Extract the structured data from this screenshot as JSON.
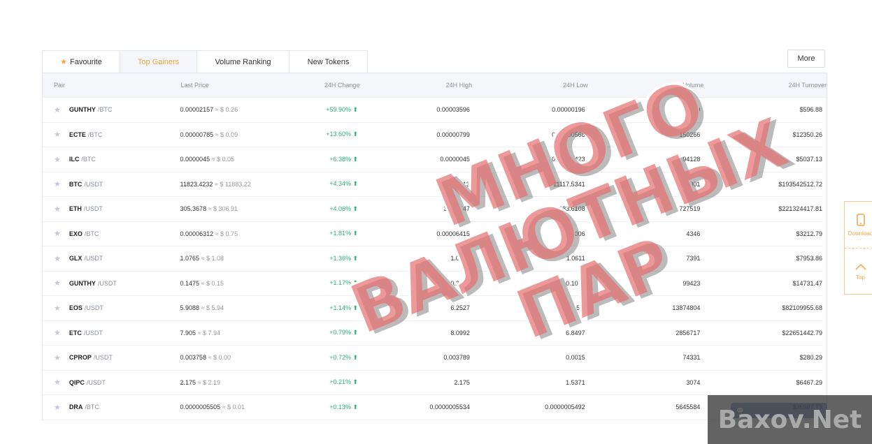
{
  "tabs": [
    {
      "label": "Favourite",
      "icon": "star-icon"
    },
    {
      "label": "Top Gainers",
      "active": true
    },
    {
      "label": "Volume Ranking"
    },
    {
      "label": "New Tokens"
    }
  ],
  "more_label": "More",
  "columns": [
    "Pair",
    "Last Price",
    "24H Change",
    "24H High",
    "24H Low",
    "24H Volume",
    "24H Turnover"
  ],
  "rows": [
    {
      "base": "GUNTHY",
      "quote": "/BTC",
      "price": "0.00002157",
      "usd": "≈ $ 0.26",
      "change": "+59.90%",
      "high": "0.00003596",
      "low": "0.00000196",
      "volume": "2889",
      "turnover": "$596.88"
    },
    {
      "base": "ECTE",
      "quote": "/BTC",
      "price": "0.00000785",
      "usd": "≈ $ 0.09",
      "change": "+13.60%",
      "high": "0.00000799",
      "low": "0.00000568",
      "volume": "150266",
      "turnover": "$12350.26"
    },
    {
      "base": "ILC",
      "quote": "/BTC",
      "price": "0.0000045",
      "usd": "≈ $ 0.05",
      "change": "+6.38%",
      "high": "0.0000045",
      "low": "0.00000423",
      "volume": "94128",
      "turnover": "$5037.13"
    },
    {
      "base": "BTC",
      "quote": "/USDT",
      "price": "11823.4232",
      "usd": "≈ $ 11883.22",
      "change": "+4.34%",
      "high": "11930.1813",
      "low": "11117.5341",
      "volume": "16801",
      "turnover": "$193542512.72"
    },
    {
      "base": "ETH",
      "quote": "/USDT",
      "price": "305.3678",
      "usd": "≈ $ 306.91",
      "change": "+4.06%",
      "high": "310.1747",
      "low": "283.6108",
      "volume": "727519",
      "turnover": "$221324417.81"
    },
    {
      "base": "EXO",
      "quote": "/BTC",
      "price": "0.00006312",
      "usd": "≈ $ 0.75",
      "change": "+1.81%",
      "high": "0.00006415",
      "low": "0.00006",
      "volume": "4346",
      "turnover": "$3212.79"
    },
    {
      "base": "GLX",
      "quote": "/USDT",
      "price": "1.0765",
      "usd": "≈ $ 1.08",
      "change": "+1.36%",
      "high": "1.0787",
      "low": "1.0611",
      "volume": "7391",
      "turnover": "$7953.86"
    },
    {
      "base": "GUNTHY",
      "quote": "/USDT",
      "price": "0.1475",
      "usd": "≈ $ 0.15",
      "change": "+1.17%",
      "high": "0.2208",
      "low": "0.1075",
      "volume": "99423",
      "turnover": "$14731.47"
    },
    {
      "base": "EOS",
      "quote": "/USDT",
      "price": "5.9088",
      "usd": "≈ $ 5.94",
      "change": "+1.14%",
      "high": "6.2527",
      "low": "5.5",
      "volume": "13874804",
      "turnover": "$82109955.68"
    },
    {
      "base": "ETC",
      "quote": "/USDT",
      "price": "7.905",
      "usd": "≈ $ 7.94",
      "change": "+0.79%",
      "high": "8.0992",
      "low": "6.8497",
      "volume": "2856717",
      "turnover": "$22651442.79"
    },
    {
      "base": "CPROP",
      "quote": "/USDT",
      "price": "0.003758",
      "usd": "≈ $ 0.00",
      "change": "+0.72%",
      "high": "0.003789",
      "low": "0.0015",
      "volume": "74331",
      "turnover": "$280.29"
    },
    {
      "base": "QIPC",
      "quote": "/USDT",
      "price": "2.175",
      "usd": "≈ $ 2.19",
      "change": "+0.21%",
      "high": "2.175",
      "low": "1.5371",
      "volume": "3074",
      "turnover": "$6467.29"
    },
    {
      "base": "DRA",
      "quote": "/BTC",
      "price": "0.0000005505",
      "usd": "≈ $ 0.01",
      "change": "+0.13%",
      "high": "0.0000005534",
      "low": "0.0000005492",
      "volume": "5645584",
      "turnover": "$36987.73"
    }
  ],
  "side": {
    "download": "Download",
    "top": "Top"
  },
  "watermark": {
    "line1": "МНОГО",
    "line2": "ВАЛЮТНЫХ ПАР",
    "logo": "Baxov.Net"
  },
  "colors": {
    "accent": "#f7a440",
    "up": "#2cb276"
  }
}
